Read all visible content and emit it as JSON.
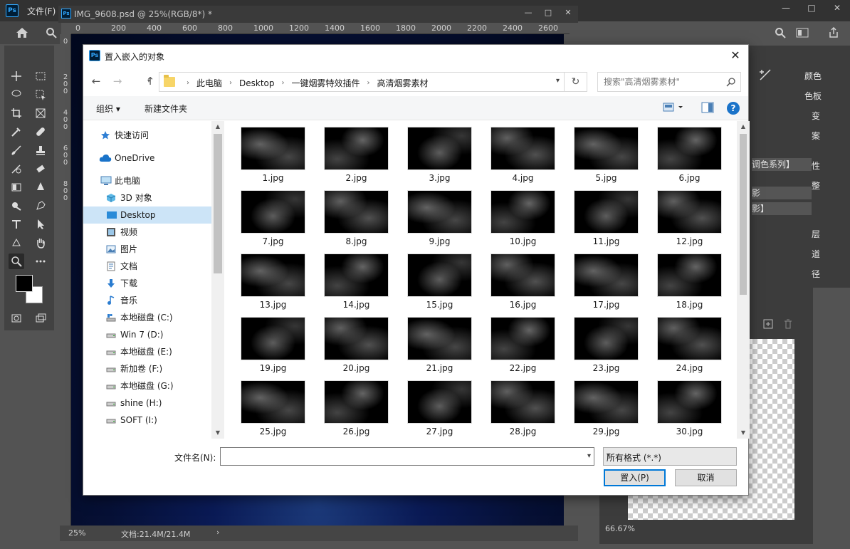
{
  "app": {
    "logo": "Ps",
    "menu_label": "文件(F)",
    "window_buttons": [
      "—",
      "□",
      "✕"
    ]
  },
  "document": {
    "tab_icon": "Ps",
    "tab_title": "IMG_9608.psd @ 25%(RGB/8*) *",
    "tab_buttons": [
      "—",
      "□",
      "✕"
    ],
    "ruler_h": [
      "0",
      "200",
      "400",
      "600",
      "800",
      "1000",
      "1200",
      "1400",
      "1600",
      "1800",
      "2000",
      "2200",
      "2400",
      "2600"
    ],
    "ruler_v": [
      "0",
      "200",
      "400",
      "600",
      "800"
    ],
    "status_zoom": "25%",
    "status_doc": "文档:21.4M/21.4M",
    "status_arrow": "›"
  },
  "right_panel": {
    "items": [
      "颜色",
      "色板",
      "变",
      "案",
      "性",
      "整",
      "层",
      "道",
      "径"
    ],
    "rows": [
      "调色系列】",
      "影",
      "影】"
    ],
    "zoom": "66.67%"
  },
  "dialog": {
    "title_icon": "Ps",
    "title": "置入嵌入的对象",
    "close": "✕",
    "nav": {
      "back": "←",
      "forward": "→",
      "up": "↑",
      "refresh": "↻"
    },
    "breadcrumbs": [
      "此电脑",
      "Desktop",
      "一键烟雾特效插件",
      "高清烟雾素材"
    ],
    "search_placeholder": "搜索\"高清烟雾素材\"",
    "organize": "组织 ▾",
    "new_folder": "新建文件夹",
    "help": "?",
    "nav_items": [
      {
        "label": "快速访问",
        "icon": "star-icon"
      },
      {
        "label": "OneDrive",
        "icon": "cloud-icon"
      },
      {
        "label": "此电脑",
        "icon": "computer-icon"
      },
      {
        "label": "3D 对象",
        "icon": "cube-icon"
      },
      {
        "label": "Desktop",
        "icon": "desktop-icon"
      },
      {
        "label": "视频",
        "icon": "video-icon"
      },
      {
        "label": "图片",
        "icon": "picture-icon"
      },
      {
        "label": "文档",
        "icon": "document-icon"
      },
      {
        "label": "下载",
        "icon": "download-icon"
      },
      {
        "label": "音乐",
        "icon": "music-icon"
      },
      {
        "label": "本地磁盘 (C:)",
        "icon": "drive-icon"
      },
      {
        "label": "Win 7 (D:)",
        "icon": "drive-icon"
      },
      {
        "label": "本地磁盘 (E:)",
        "icon": "drive-icon"
      },
      {
        "label": "新加卷 (F:)",
        "icon": "drive-icon"
      },
      {
        "label": "本地磁盘 (G:)",
        "icon": "drive-icon"
      },
      {
        "label": "shine (H:)",
        "icon": "drive-icon"
      },
      {
        "label": "SOFT (I:)",
        "icon": "drive-icon"
      }
    ],
    "selected_nav": "Desktop",
    "files": [
      "1.jpg",
      "2.jpg",
      "3.jpg",
      "4.jpg",
      "5.jpg",
      "6.jpg",
      "7.jpg",
      "8.jpg",
      "9.jpg",
      "10.jpg",
      "11.jpg",
      "12.jpg",
      "13.jpg",
      "14.jpg",
      "15.jpg",
      "16.jpg",
      "17.jpg",
      "18.jpg",
      "19.jpg",
      "20.jpg",
      "21.jpg",
      "22.jpg",
      "23.jpg",
      "24.jpg",
      "25.jpg",
      "26.jpg",
      "27.jpg",
      "28.jpg",
      "29.jpg",
      "30.jpg"
    ],
    "filename_label": "文件名(N):",
    "filename_value": "",
    "filetype": "所有格式 (*.*)",
    "place_button": "置入(P)",
    "cancel_button": "取消"
  },
  "colors": {
    "selected_nav_bg": "#cce4f7",
    "primary_button_border": "#0078d7",
    "help_blue": "#1a73c9"
  }
}
